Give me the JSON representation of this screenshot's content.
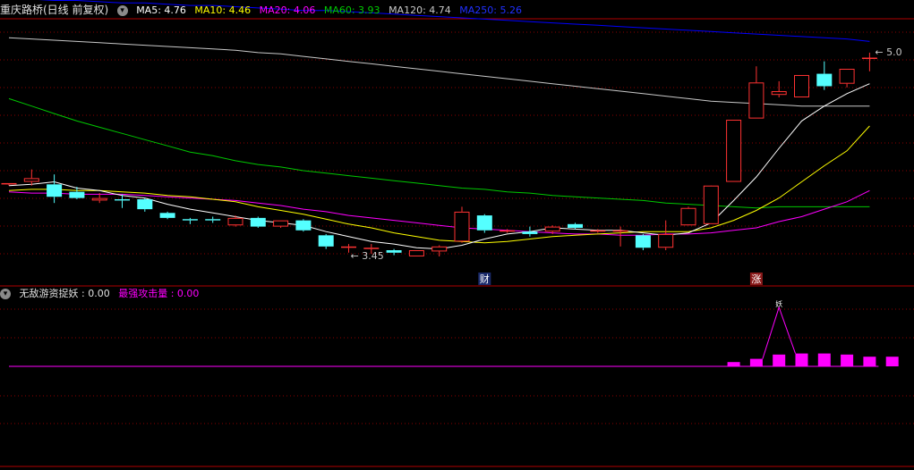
{
  "header": {
    "title": "重庆路桥(日线 前复权)",
    "ma5": "MA5: 4.76",
    "ma10": "MA10: 4.46",
    "ma20": "MA20: 4.06",
    "ma60": "MA60: 3.93",
    "ma120": "MA120: 4.74",
    "ma250": "MA250: 5.26"
  },
  "indicator": {
    "name": "无敌游资捉妖",
    "value1": ": 0.00",
    "label2": "最强攻击量",
    "value2": ": 0.00",
    "peak_label": "妖"
  },
  "annotations": {
    "low_price": "3.45",
    "high_price": "5.0",
    "marker_cai": "财",
    "marker_zhang": "涨"
  },
  "colors": {
    "up": "#ff3232",
    "down": "#54ffff",
    "ma5": "#ffffff",
    "ma10": "#ffff00",
    "ma20": "#ff00ff",
    "ma60": "#00c800",
    "ma120": "#c8c8c8",
    "ma250": "#0000ff",
    "grid": "#8b0000"
  },
  "chart_data": {
    "type": "candlestick",
    "ylim": [
      3.35,
      5.45
    ],
    "candles": [
      {
        "o": 4.11,
        "h": 4.12,
        "l": 4.1,
        "c": 4.12
      },
      {
        "o": 4.13,
        "h": 4.23,
        "l": 4.1,
        "c": 4.16
      },
      {
        "o": 4.11,
        "h": 4.19,
        "l": 3.96,
        "c": 4.01
      },
      {
        "o": 4.05,
        "h": 4.09,
        "l": 3.99,
        "c": 4.0
      },
      {
        "o": 3.98,
        "h": 4.04,
        "l": 3.96,
        "c": 4.0
      },
      {
        "o": 3.99,
        "h": 4.03,
        "l": 3.92,
        "c": 3.98
      },
      {
        "o": 3.99,
        "h": 4.0,
        "l": 3.89,
        "c": 3.91
      },
      {
        "o": 3.88,
        "h": 3.89,
        "l": 3.83,
        "c": 3.84
      },
      {
        "o": 3.83,
        "h": 3.84,
        "l": 3.79,
        "c": 3.82
      },
      {
        "o": 3.83,
        "h": 3.85,
        "l": 3.8,
        "c": 3.82
      },
      {
        "o": 3.78,
        "h": 3.86,
        "l": 3.77,
        "c": 3.84
      },
      {
        "o": 3.84,
        "h": 3.85,
        "l": 3.76,
        "c": 3.77
      },
      {
        "o": 3.77,
        "h": 3.82,
        "l": 3.76,
        "c": 3.82
      },
      {
        "o": 3.82,
        "h": 3.83,
        "l": 3.73,
        "c": 3.74
      },
      {
        "o": 3.7,
        "h": 3.71,
        "l": 3.59,
        "c": 3.61
      },
      {
        "o": 3.6,
        "h": 3.63,
        "l": 3.56,
        "c": 3.61
      },
      {
        "o": 3.59,
        "h": 3.63,
        "l": 3.55,
        "c": 3.6
      },
      {
        "o": 3.58,
        "h": 3.59,
        "l": 3.54,
        "c": 3.56
      },
      {
        "o": 3.53,
        "h": 3.58,
        "l": 3.53,
        "c": 3.58
      },
      {
        "o": 3.57,
        "h": 3.62,
        "l": 3.53,
        "c": 3.61
      },
      {
        "o": 3.65,
        "h": 3.93,
        "l": 3.64,
        "c": 3.89
      },
      {
        "o": 3.86,
        "h": 3.87,
        "l": 3.72,
        "c": 3.74
      },
      {
        "o": 3.74,
        "h": 3.75,
        "l": 3.72,
        "c": 3.74
      },
      {
        "o": 3.73,
        "h": 3.77,
        "l": 3.69,
        "c": 3.71
      },
      {
        "o": 3.73,
        "h": 3.78,
        "l": 3.71,
        "c": 3.77
      },
      {
        "o": 3.79,
        "h": 3.8,
        "l": 3.75,
        "c": 3.76
      },
      {
        "o": 3.74,
        "h": 3.75,
        "l": 3.72,
        "c": 3.74
      },
      {
        "o": 3.74,
        "h": 3.77,
        "l": 3.61,
        "c": 3.74
      },
      {
        "o": 3.7,
        "h": 3.71,
        "l": 3.58,
        "c": 3.6
      },
      {
        "o": 3.6,
        "h": 3.82,
        "l": 3.58,
        "c": 3.71
      },
      {
        "o": 3.78,
        "h": 3.93,
        "l": 3.78,
        "c": 3.92
      },
      {
        "o": 3.79,
        "h": 4.01,
        "l": 3.79,
        "c": 4.1
      },
      {
        "o": 4.13,
        "h": 4.63,
        "l": 4.13,
        "c": 4.63
      },
      {
        "o": 4.64,
        "h": 5.06,
        "l": 4.64,
        "c": 4.93
      },
      {
        "o": 4.83,
        "h": 4.94,
        "l": 4.81,
        "c": 4.86
      },
      {
        "o": 4.81,
        "h": 4.99,
        "l": 4.81,
        "c": 4.99
      },
      {
        "o": 5.0,
        "h": 5.1,
        "l": 4.87,
        "c": 4.9
      },
      {
        "o": 4.92,
        "h": 5.04,
        "l": 4.89,
        "c": 5.04
      },
      {
        "o": 5.13,
        "h": 5.17,
        "l": 5.02,
        "c": 5.13
      }
    ],
    "ma5": [
      4.1,
      4.11,
      4.13,
      4.08,
      4.06,
      4.02,
      4.0,
      3.95,
      3.91,
      3.88,
      3.85,
      3.82,
      3.8,
      3.78,
      3.73,
      3.69,
      3.65,
      3.63,
      3.6,
      3.59,
      3.62,
      3.67,
      3.71,
      3.73,
      3.76,
      3.75,
      3.74,
      3.74,
      3.72,
      3.7,
      3.72,
      3.8,
      3.98,
      4.17,
      4.4,
      4.62,
      4.74,
      4.84,
      4.92
    ],
    "ma10": [
      4.06,
      4.07,
      4.07,
      4.06,
      4.06,
      4.05,
      4.04,
      4.02,
      4.01,
      3.99,
      3.97,
      3.93,
      3.9,
      3.87,
      3.83,
      3.79,
      3.76,
      3.72,
      3.69,
      3.66,
      3.65,
      3.64,
      3.65,
      3.67,
      3.69,
      3.7,
      3.71,
      3.72,
      3.73,
      3.73,
      3.73,
      3.76,
      3.82,
      3.9,
      4.0,
      4.13,
      4.26,
      4.38,
      4.58
    ],
    "ma20": [
      4.05,
      4.04,
      4.04,
      4.03,
      4.03,
      4.03,
      4.02,
      4.01,
      4.0,
      3.99,
      3.98,
      3.96,
      3.94,
      3.91,
      3.89,
      3.86,
      3.84,
      3.82,
      3.8,
      3.78,
      3.76,
      3.75,
      3.74,
      3.73,
      3.72,
      3.71,
      3.71,
      3.7,
      3.7,
      3.71,
      3.71,
      3.72,
      3.74,
      3.76,
      3.81,
      3.85,
      3.91,
      3.97,
      4.06
    ],
    "ma60": [
      4.8,
      4.74,
      4.68,
      4.62,
      4.57,
      4.52,
      4.47,
      4.42,
      4.37,
      4.34,
      4.3,
      4.27,
      4.25,
      4.22,
      4.2,
      4.18,
      4.16,
      4.14,
      4.12,
      4.1,
      4.08,
      4.07,
      4.05,
      4.04,
      4.02,
      4.01,
      4.0,
      3.99,
      3.98,
      3.96,
      3.95,
      3.94,
      3.93,
      3.92,
      3.93,
      3.93,
      3.93,
      3.93,
      3.93
    ],
    "ma120": [
      5.29,
      5.28,
      5.27,
      5.26,
      5.25,
      5.24,
      5.23,
      5.22,
      5.21,
      5.2,
      5.19,
      5.17,
      5.16,
      5.14,
      5.12,
      5.1,
      5.08,
      5.06,
      5.04,
      5.02,
      5.0,
      4.98,
      4.96,
      4.94,
      4.92,
      4.9,
      4.88,
      4.86,
      4.84,
      4.82,
      4.8,
      4.78,
      4.77,
      4.76,
      4.75,
      4.74,
      4.74,
      4.74,
      4.74
    ],
    "ma250": [
      5.6,
      5.6,
      5.59,
      5.59,
      5.58,
      5.57,
      5.57,
      5.56,
      5.55,
      5.55,
      5.54,
      5.53,
      5.52,
      5.51,
      5.51,
      5.5,
      5.49,
      5.48,
      5.47,
      5.46,
      5.45,
      5.44,
      5.43,
      5.42,
      5.41,
      5.4,
      5.39,
      5.38,
      5.37,
      5.36,
      5.35,
      5.34,
      5.33,
      5.32,
      5.31,
      5.3,
      5.29,
      5.28,
      5.26
    ],
    "indicator_bars": [
      0,
      0,
      0,
      0,
      0,
      0,
      0,
      0,
      0,
      0,
      0,
      0,
      0,
      0,
      0,
      0,
      0,
      0,
      0,
      0,
      0,
      0,
      0,
      0,
      0,
      0,
      0,
      0,
      0,
      0,
      0,
      0,
      0.4,
      0.7,
      1.1,
      1.2,
      1.2,
      1.1,
      0.9,
      0.9
    ],
    "indicator_peak": {
      "index": 34,
      "value": 5.5
    }
  }
}
